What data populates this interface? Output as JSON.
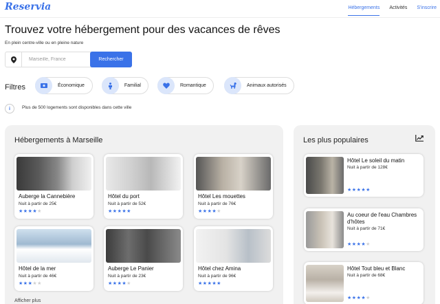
{
  "header": {
    "logo": "Reservia",
    "nav": [
      "Hébergements",
      "Activités",
      "S'inscrire"
    ]
  },
  "hero": {
    "title": "Trouvez votre hébergement pour des vacances de rêves",
    "subtitle": "En plein centre-ville ou en pleine nature"
  },
  "search": {
    "icon": "location-pin-icon",
    "placeholder": "Marseille, France",
    "button": "Rechercher"
  },
  "filters": {
    "label": "Filtres",
    "items": [
      {
        "icon": "money-icon",
        "label": "Économique"
      },
      {
        "icon": "family-icon",
        "label": "Familial"
      },
      {
        "icon": "heart-icon",
        "label": "Romantique"
      },
      {
        "icon": "dog-icon",
        "label": "Animaux autorisés"
      }
    ]
  },
  "info": {
    "icon": "info-icon",
    "text": "Plus de 500 logements sont disponibles dans cette ville"
  },
  "accommodations": {
    "title": "Hébergements à Marseille",
    "items": [
      {
        "name": "Auberge la Cannebière",
        "price": "Nuit à partir de 25€",
        "rating": 4
      },
      {
        "name": "Hôtel du port",
        "price": "Nuit à partir de 52€",
        "rating": 5
      },
      {
        "name": "Hôtel Les mouettes",
        "price": "Nuit à partir de 76€",
        "rating": 4
      },
      {
        "name": "Hôtel de la mer",
        "price": "Nuit à partir de 46€",
        "rating": 3
      },
      {
        "name": "Auberge Le Panier",
        "price": "Nuit à partir de 23€",
        "rating": 4
      },
      {
        "name": "Hôtel chez Amina",
        "price": "Nuit à partir de 96€",
        "rating": 5
      }
    ],
    "show_more": "Afficher plus"
  },
  "popular": {
    "title": "Les plus populaires",
    "icon": "trending-chart-icon",
    "items": [
      {
        "name": "Hôtel Le soleil du matin",
        "price": "Nuit à partir de 128€",
        "rating": 5
      },
      {
        "name": "Au coeur de l'eau Chambres d'hôtes",
        "price": "Nuit à partir de 71€",
        "rating": 4
      },
      {
        "name": "Hôtel Tout bleu et Blanc",
        "price": "Nuit à partir de 68€",
        "rating": 4
      }
    ]
  },
  "colors": {
    "accent": "#3a72e8",
    "chip_icon_bg": "#dbe6fb",
    "panel_bg": "#f1f1f1"
  }
}
